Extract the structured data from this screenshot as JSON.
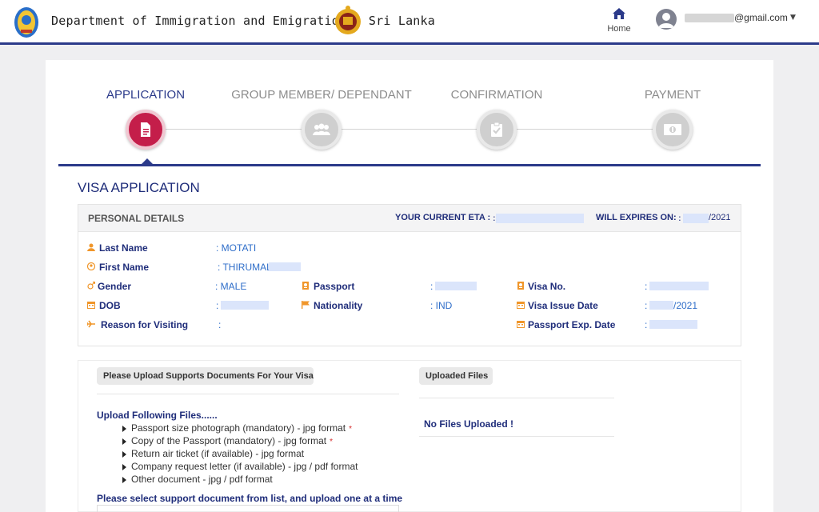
{
  "header": {
    "site_title": "Department of Immigration and Emigration - Sri Lanka",
    "home_label": "Home",
    "user_email_suffix": "@gmail.com"
  },
  "steps": [
    {
      "label": "APPLICATION",
      "active": true,
      "icon": "document-icon"
    },
    {
      "label": "GROUP MEMBER/ DEPENDANT",
      "active": false,
      "icon": "group-icon"
    },
    {
      "label": "CONFIRMATION",
      "active": false,
      "icon": "clipboard-check-icon"
    },
    {
      "label": "PAYMENT",
      "active": false,
      "icon": "banknote-icon"
    }
  ],
  "section_title": "VISA APPLICATION",
  "personal": {
    "title": "PERSONAL DETAILS",
    "eta_label": "YOUR CURRENT ETA :",
    "eta_colon": ":",
    "expires_label": "WILL EXPIRES ON:",
    "expires_colon": ":",
    "expires_value": "/2021",
    "fields": {
      "last_name": {
        "label": "Last Name",
        "value": ": MOTATI"
      },
      "first_name": {
        "label": "First Name",
        "value": ": THIRUMAL"
      },
      "gender": {
        "label": "Gender",
        "value": ": MALE"
      },
      "dob": {
        "label": "DOB",
        "value": ":"
      },
      "reason": {
        "label": "Reason for Visiting",
        "value": ":"
      },
      "passport": {
        "label": "Passport",
        "value": ":"
      },
      "nationality": {
        "label": "Nationality",
        "value": ": IND"
      },
      "visa_no": {
        "label": "Visa No.",
        "value": ":"
      },
      "visa_issue": {
        "label": "Visa Issue Date",
        "value": ":",
        "suffix": "/2021"
      },
      "passport_exp": {
        "label": "Passport Exp. Date",
        "value": ":"
      }
    }
  },
  "upload": {
    "left_title": "Please Upload Supports Documents For Your Visa",
    "right_title": "Uploaded Files",
    "files_heading": "Upload Following Files......",
    "files": [
      {
        "text": "Passport size photograph (mandatory) - jpg format",
        "required": true
      },
      {
        "text": "Copy of the Passport (mandatory) - jpg format",
        "required": true
      },
      {
        "text": "Return air ticket (if available) - jpg format",
        "required": false
      },
      {
        "text": "Company request letter (if available) - jpg / pdf format",
        "required": false
      },
      {
        "text": "Other document - jpg / pdf format",
        "required": false
      }
    ],
    "required_mark": "*",
    "no_files": "No Files Uploaded !",
    "select_instruction": "Please select support document from list, and upload one at a time"
  },
  "colors": {
    "brand_blue": "#2b3a8a",
    "active_step": "#c41e4a",
    "value_blue": "#2f6ec9",
    "icon_orange": "#f0962a"
  }
}
